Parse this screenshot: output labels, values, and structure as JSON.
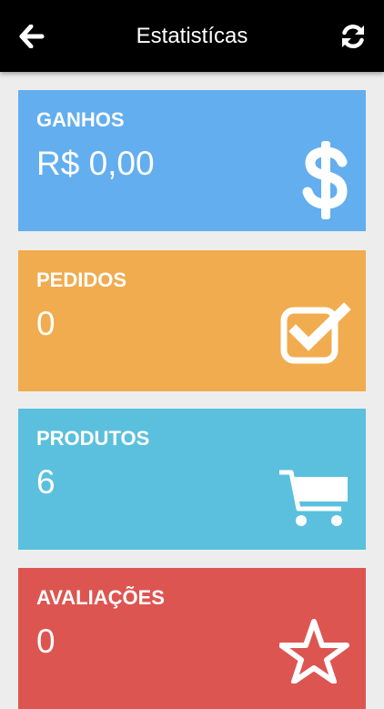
{
  "header": {
    "title": "Estatistícas",
    "back_icon": "arrow-left-icon",
    "refresh_icon": "refresh-icon",
    "background": "#000000"
  },
  "cards": [
    {
      "label": "GANHOS",
      "value": "R$ 0,00",
      "icon": "dollar-icon",
      "color": "#63aeee"
    },
    {
      "label": "PEDIDOS",
      "value": "0",
      "icon": "check-square-icon",
      "color": "#f0ac4f"
    },
    {
      "label": "PRODUTOS",
      "value": "6",
      "icon": "shopping-cart-icon",
      "color": "#5bc0dd"
    },
    {
      "label": "AVALIAÇÕES",
      "value": "0",
      "icon": "star-icon",
      "color": "#dd5551"
    }
  ]
}
